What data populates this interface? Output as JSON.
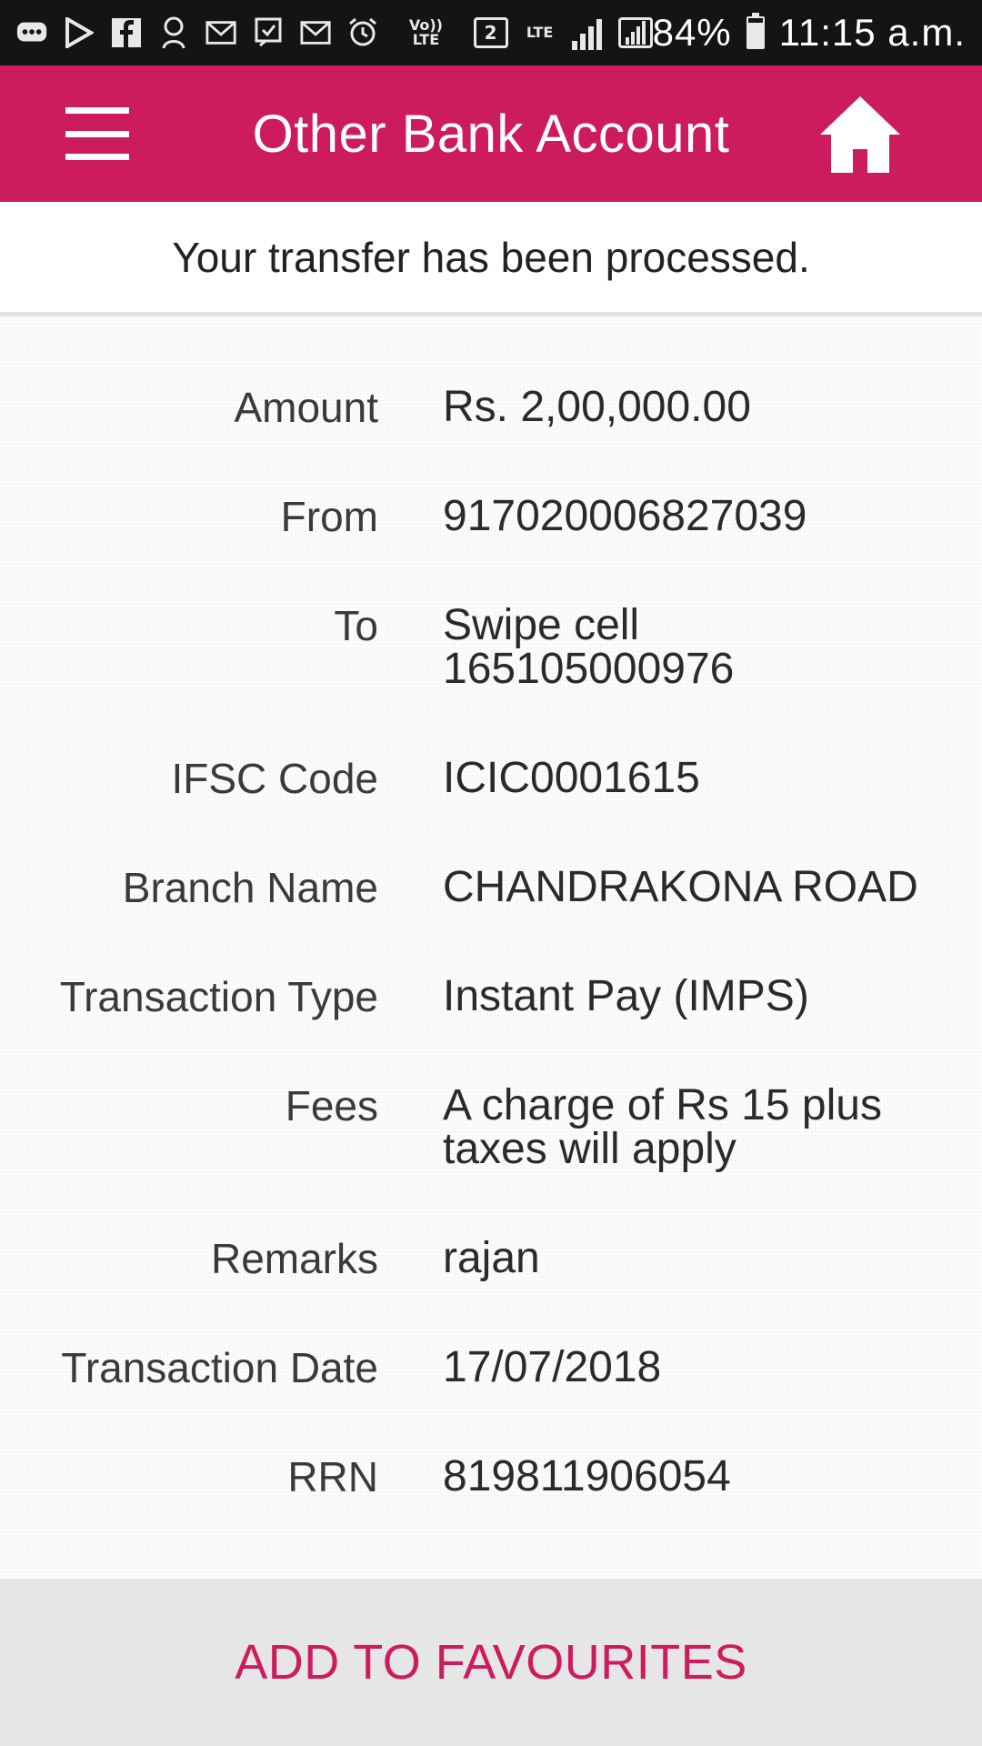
{
  "status_bar": {
    "icons": [
      "message-icon",
      "play-store-icon",
      "facebook-icon",
      "sticker-icon",
      "gmail-icon",
      "notification-icon",
      "gmail-icon",
      "alarm-icon",
      "volte-icon",
      "sim-2-icon",
      "lte-icon",
      "signal-icon",
      "signal-icon"
    ],
    "volte_label": "Vo)) LTE",
    "sim_label": "2",
    "lte_label": "LTE",
    "battery": "84%",
    "battery_level": 0.84,
    "time": "11:15 a.m."
  },
  "app_bar": {
    "title": "Other Bank Account",
    "background_color": "#cd1c5e",
    "menu_icon": "hamburger-menu-icon",
    "home_icon": "home-icon"
  },
  "message": "Your transfer has been processed.",
  "details": [
    {
      "label": "Amount",
      "value": "Rs. 2,00,000.00"
    },
    {
      "label": "From",
      "value": "917020006827039"
    },
    {
      "label": "To",
      "value": [
        "Swipe cell",
        "165105000976"
      ]
    },
    {
      "label": "IFSC Code",
      "value": "ICIC0001615"
    },
    {
      "label": "Branch Name",
      "value": "CHANDRAKONA ROAD"
    },
    {
      "label": "Transaction Type",
      "value": "Instant Pay (IMPS)"
    },
    {
      "label": "Fees",
      "value": [
        "A charge of Rs 15 plus",
        "taxes will apply"
      ]
    },
    {
      "label": "Remarks",
      "value": "rajan"
    },
    {
      "label": "Transaction Date",
      "value": "17/07/2018"
    },
    {
      "label": "RRN",
      "value": "819811906054"
    }
  ],
  "footer": {
    "button_label": "ADD TO FAVOURITES",
    "accent_color": "#cd1c5e"
  }
}
